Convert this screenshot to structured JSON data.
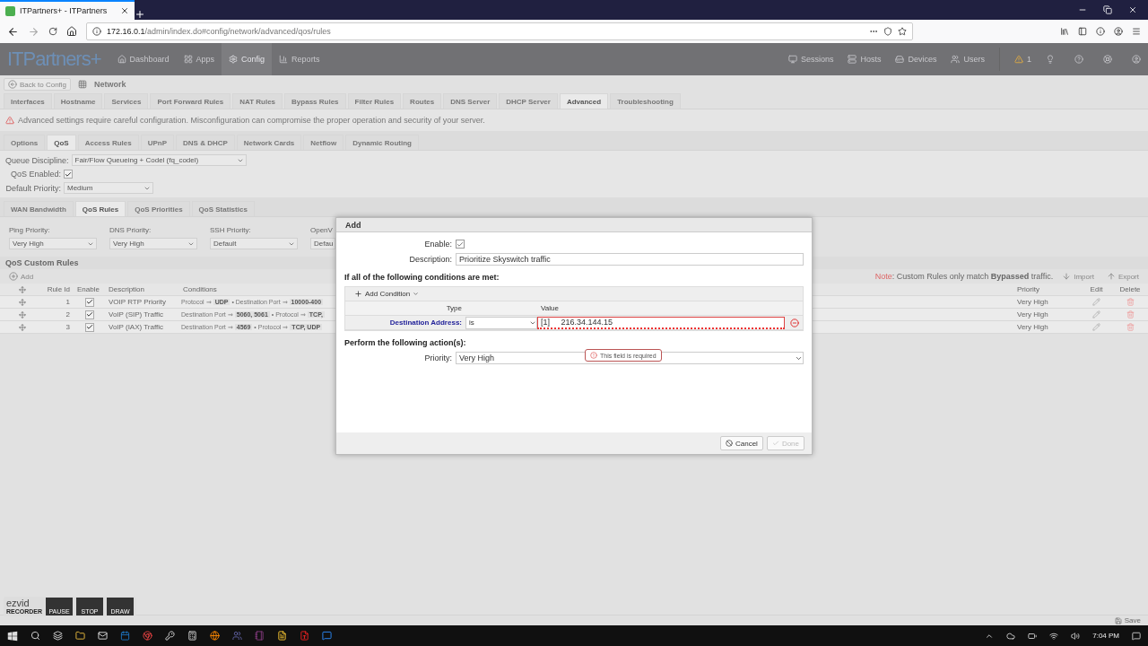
{
  "browser": {
    "tab_title": "ITPartners+ - ITPartners",
    "url_host": "172.16.0.1",
    "url_path": "/admin/index.do#config/network/advanced/qos/rules"
  },
  "app_header": {
    "logo": "ITPartners+",
    "nav": [
      {
        "label": "Dashboard",
        "selected": false
      },
      {
        "label": "Apps",
        "selected": false
      },
      {
        "label": "Config",
        "selected": true
      },
      {
        "label": "Reports",
        "selected": false
      }
    ],
    "right_nav": [
      "Sessions",
      "Hosts",
      "Devices",
      "Users"
    ],
    "alert_count": "1"
  },
  "breadcrumb": {
    "back": "Back to Config",
    "title": "Network"
  },
  "tabs": [
    {
      "label": "Interfaces",
      "selected": false
    },
    {
      "label": "Hostname",
      "selected": false
    },
    {
      "label": "Services",
      "selected": false
    },
    {
      "label": "Port Forward Rules",
      "selected": false
    },
    {
      "label": "NAT Rules",
      "selected": false
    },
    {
      "label": "Bypass Rules",
      "selected": false
    },
    {
      "label": "Filter Rules",
      "selected": false
    },
    {
      "label": "Routes",
      "selected": false
    },
    {
      "label": "DNS Server",
      "selected": false
    },
    {
      "label": "DHCP Server",
      "selected": false
    },
    {
      "label": "Advanced",
      "selected": true
    },
    {
      "label": "Troubleshooting",
      "selected": false
    }
  ],
  "warning": "Advanced settings require careful configuration. Misconfiguration can compromise the proper operation and security of your server.",
  "subtabs": [
    {
      "label": "Options",
      "selected": false
    },
    {
      "label": "QoS",
      "selected": true
    },
    {
      "label": "Access Rules",
      "selected": false
    },
    {
      "label": "UPnP",
      "selected": false
    },
    {
      "label": "DNS & DHCP",
      "selected": false
    },
    {
      "label": "Network Cards",
      "selected": false
    },
    {
      "label": "Netflow",
      "selected": false
    },
    {
      "label": "Dynamic Routing",
      "selected": false
    }
  ],
  "settings": {
    "queue_discipline": {
      "label": "Queue Discipline:",
      "value": "Fair/Flow Queueing + Codel (fq_codel)"
    },
    "qos_enabled": {
      "label": "QoS Enabled:",
      "checked": true
    },
    "default_priority": {
      "label": "Default Priority:",
      "value": "Medium"
    }
  },
  "rule_tabs": [
    {
      "label": "WAN Bandwidth",
      "selected": false
    },
    {
      "label": "QoS Rules",
      "selected": true
    },
    {
      "label": "QoS Priorities",
      "selected": false
    },
    {
      "label": "QoS Statistics",
      "selected": false
    }
  ],
  "priorities": [
    {
      "label": "Ping Priority:",
      "value": "Very High"
    },
    {
      "label": "DNS Priority:",
      "value": "Very High"
    },
    {
      "label": "SSH Priority:",
      "value": "Default"
    },
    {
      "label": "OpenV",
      "value": "Defau"
    }
  ],
  "custom_rules": {
    "title": "QoS Custom Rules",
    "add": "Add",
    "note_label": "Note",
    "note_text": ": Custom Rules only match **Bypassed** traffic.",
    "import": "Import",
    "export": "Export",
    "columns": [
      "Rule Id",
      "Enable",
      "Description",
      "Conditions",
      "Priority",
      "Edit",
      "Delete"
    ],
    "rows": [
      {
        "id": "1",
        "enabled": true,
        "description": "VOIP RTP Priority",
        "conditions": [
          {
            "name": "Protocol ⇒",
            "value": "UDP"
          },
          {
            "name": "• Destination Port ⇒",
            "value": "10000-400"
          }
        ],
        "priority": "Very High"
      },
      {
        "id": "2",
        "enabled": true,
        "description": "VoIP (SIP) Traffic",
        "conditions": [
          {
            "name": "Destination Port ⇒",
            "value": "5060, 5061"
          },
          {
            "name": "• Protocol ⇒",
            "value": "TCP,"
          }
        ],
        "priority": "Very High"
      },
      {
        "id": "3",
        "enabled": true,
        "description": "VoIP (IAX) Traffic",
        "conditions": [
          {
            "name": "Destination Port ⇒",
            "value": "4569"
          },
          {
            "name": "• Protocol ⇒",
            "value": "TCP, UDP"
          }
        ],
        "priority": "Very High"
      }
    ]
  },
  "dialog": {
    "title": "Add",
    "enable": {
      "label": "Enable:",
      "checked": true
    },
    "description": {
      "label": "Description:",
      "value": "Prioritize Skyswitch traffic"
    },
    "conditions_heading": "If all of the following conditions are met:",
    "add_condition": "Add Condition",
    "columns": [
      "Type",
      "Value"
    ],
    "condition": {
      "type": "Destination Address:",
      "operator": "is",
      "value": "[1]     216.34.144.15",
      "invalid": true,
      "error": "This field is required"
    },
    "actions_heading": "Perform the following action(s):",
    "priority": {
      "label": "Priority:",
      "value": "Very High"
    },
    "cancel": "Cancel",
    "done": {
      "label": "Done",
      "disabled": true
    }
  },
  "footer": {
    "save": "Save"
  },
  "recorder": {
    "logo": "ezvid",
    "sub": "RECORDER",
    "buttons": [
      "PAUSE",
      "STOP",
      "DRAW"
    ]
  },
  "taskbar": {
    "clock": "7:04 PM"
  }
}
